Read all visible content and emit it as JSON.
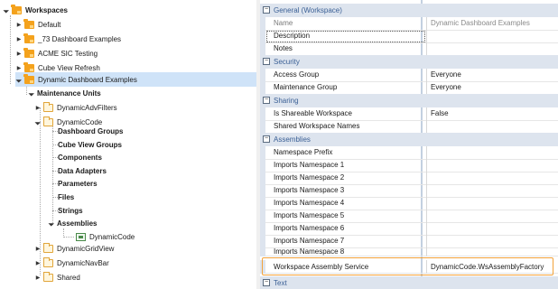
{
  "tree": {
    "root": "Workspaces",
    "workspaces": [
      "Default",
      "_73 Dashboard Examples",
      "ACME SIC Testing",
      "Cube View Refresh",
      "Dynamic Dashboard Examples"
    ],
    "maintenance_units": "Maintenance Units",
    "units": [
      "DynamicAdvFilters",
      "DynamicCode",
      "DynamicGridView",
      "DynamicNavBar",
      "Shared"
    ],
    "children": [
      "Dashboard Groups",
      "Cube View Groups",
      "Components",
      "Data Adapters",
      "Parameters",
      "Files",
      "Strings",
      "Assemblies"
    ],
    "assembly": "DynamicCode"
  },
  "grid": {
    "general": "General (Workspace)",
    "header_name": "Name",
    "header_value": "Dynamic Dashboard Examples",
    "description": "Description",
    "notes": "Notes",
    "security": "Security",
    "access_group": "Access Group",
    "access_group_value": "Everyone",
    "maintenance_group": "Maintenance Group",
    "maintenance_group_value": "Everyone",
    "sharing": "Sharing",
    "is_shareable": "Is Shareable Workspace",
    "is_shareable_value": "False",
    "shared_names": "Shared Workspace Names",
    "assemblies": "Assemblies",
    "namespace_prefix": "Namespace Prefix",
    "imports": [
      "Imports Namespace 1",
      "Imports Namespace 2",
      "Imports Namespace 3",
      "Imports Namespace 4",
      "Imports Namespace 5",
      "Imports Namespace 6",
      "Imports Namespace 7",
      "Imports Namespace 8"
    ],
    "assembly_service": "Workspace Assembly Service",
    "assembly_service_value": "DynamicCode.WsAssemblyFactory",
    "text": "Text"
  }
}
